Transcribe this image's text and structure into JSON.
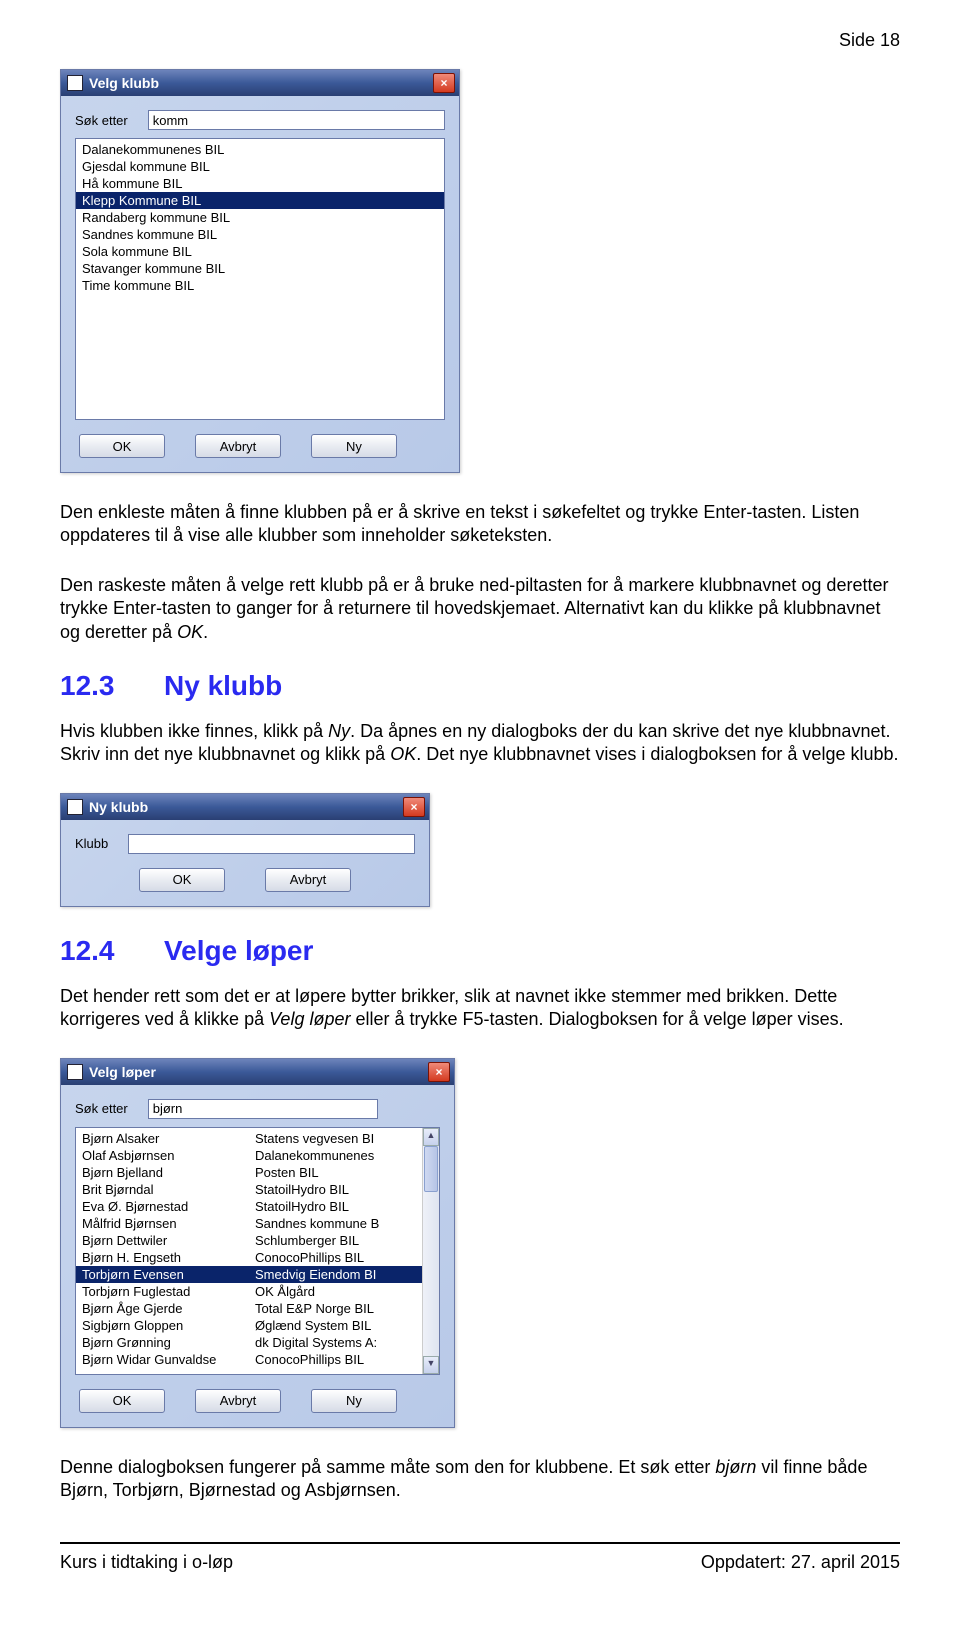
{
  "page_number": "Side 18",
  "dialog_velg_klubb": {
    "title": "Velg klubb",
    "search_label": "Søk etter",
    "search_value": "komm",
    "items": [
      "Dalanekommunenes BIL",
      "Gjesdal kommune BIL",
      "Hå kommune BIL",
      "Klepp Kommune BIL",
      "Randaberg kommune BIL",
      "Sandnes kommune BIL",
      "Sola kommune BIL",
      "Stavanger kommune BIL",
      "Time kommune BIL"
    ],
    "selected_index": 3,
    "buttons": {
      "ok": "OK",
      "cancel": "Avbryt",
      "new": "Ny"
    }
  },
  "para1": "Den enkleste måten å finne klubben på er å skrive en tekst i søkefeltet og trykke Enter-tasten. Listen oppdateres til å vise alle klubber som inneholder søketeksten.",
  "para2a": "Den raskeste måten å velge rett klubb på er å bruke ned-piltasten for å markere klubbnavnet og deretter trykke Enter-tasten to ganger for å returnere til hovedskjemaet. Alternativt kan du klikke på klubbnavnet og deretter på ",
  "para2_italic": "OK",
  "para2b": ".",
  "section_12_3": {
    "num": "12.3",
    "title": "Ny klubb"
  },
  "para3a": "Hvis klubben ikke finnes, klikk på ",
  "para3_it1": "Ny",
  "para3b": ". Da åpnes en ny dialogboks der du kan skrive det nye klubbnavnet. Skriv inn det nye klubbnavnet og klikk på ",
  "para3_it2": "OK",
  "para3c": ". Det nye klubbnavnet vises i dialogboksen for å velge klubb.",
  "dialog_ny_klubb": {
    "title": "Ny klubb",
    "label": "Klubb",
    "value": "",
    "buttons": {
      "ok": "OK",
      "cancel": "Avbryt"
    }
  },
  "section_12_4": {
    "num": "12.4",
    "title": "Velge løper"
  },
  "para4a": "Det hender rett som det er at løpere bytter brikker, slik at navnet ikke stemmer med brikken. Dette korrigeres ved å klikke på ",
  "para4_it": "Velg løper",
  "para4b": " eller å trykke F5-tasten. Dialogboksen for å velge løper vises.",
  "dialog_velg_loper": {
    "title": "Velg løper",
    "search_label": "Søk etter",
    "search_value": "bjørn",
    "names": [
      "Bjørn Alsaker",
      "Olaf Asbjørnsen",
      "Bjørn Bjelland",
      "Brit Bjørndal",
      "Eva Ø. Bjørnestad",
      "Målfrid Bjørnsen",
      "Bjørn Dettwiler",
      "Bjørn H. Engseth",
      "Torbjørn Evensen",
      "Torbjørn Fuglestad",
      "Bjørn Åge Gjerde",
      "Sigbjørn Gloppen",
      "Bjørn Grønning",
      "Bjørn Widar Gunvaldse"
    ],
    "clubs": [
      "Statens vegvesen BI",
      "Dalanekommunenes",
      "Posten BIL",
      "StatoilHydro BIL",
      "StatoilHydro BIL",
      "Sandnes kommune B",
      "Schlumberger BIL",
      "ConocoPhillips BIL",
      "Smedvig Eiendom BI",
      "OK Ålgård",
      "Total E&P Norge BIL",
      "Øglænd System BIL",
      "dk Digital Systems A:",
      "ConocoPhillips BIL"
    ],
    "selected_index": 8,
    "buttons": {
      "ok": "OK",
      "cancel": "Avbryt",
      "new": "Ny"
    }
  },
  "para5a": "Denne dialogboksen fungerer på samme måte som den for klubbene. Et søk etter ",
  "para5_it": "bjørn",
  "para5b": " vil finne både Bjørn, Torbjørn, Bjørnestad og Asbjørnsen.",
  "footer_left": "Kurs i tidtaking i o-løp",
  "footer_right": "Oppdatert: 27. april 2015",
  "close_glyph": "×",
  "up_glyph": "▲",
  "down_glyph": "▼"
}
